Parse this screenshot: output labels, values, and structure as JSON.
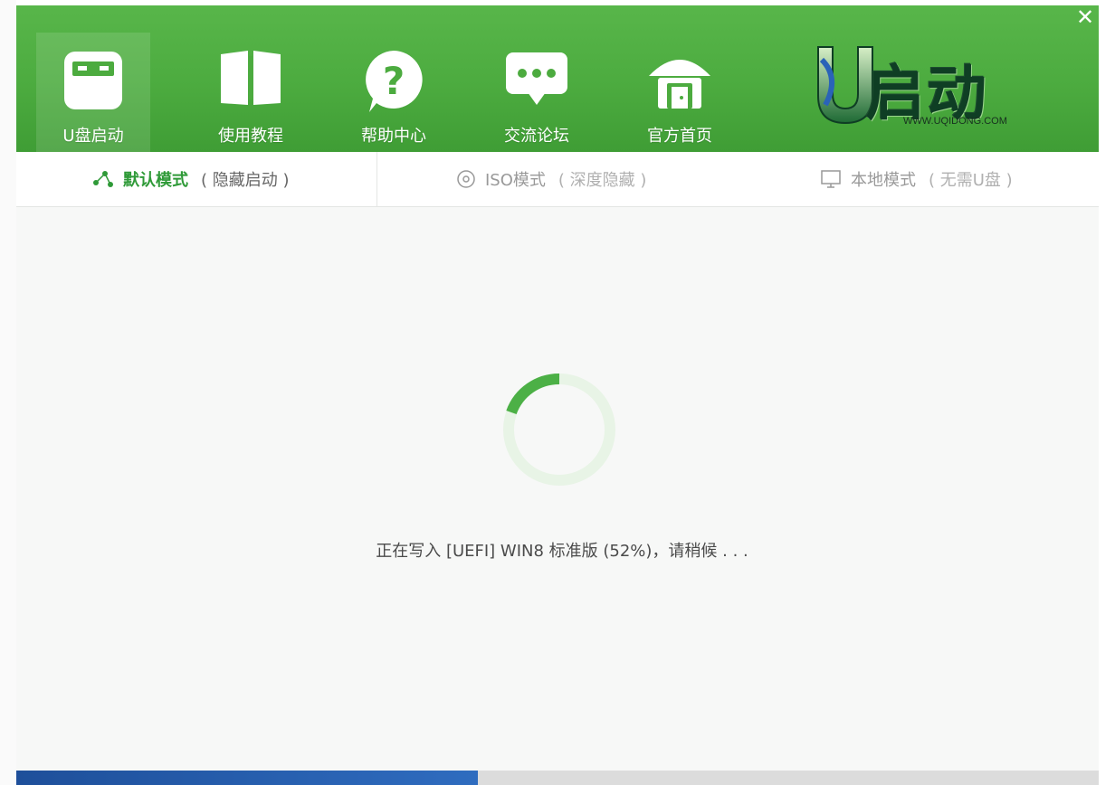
{
  "window": {
    "close_glyph": "✕"
  },
  "nav": {
    "items": [
      {
        "label": "U盘启动",
        "icon": "usb-drive-icon",
        "active": true
      },
      {
        "label": "使用教程",
        "icon": "book-icon",
        "active": false
      },
      {
        "label": "帮助中心",
        "icon": "help-icon",
        "active": false
      },
      {
        "label": "交流论坛",
        "icon": "chat-icon",
        "active": false
      },
      {
        "label": "官方首页",
        "icon": "home-icon",
        "active": false
      }
    ]
  },
  "logo": {
    "text": "启动",
    "url": "WWW.UQIDONG.COM"
  },
  "tabs": [
    {
      "label": "默认模式",
      "sub": "( 隐藏启动 )",
      "icon": "share-icon",
      "active": true
    },
    {
      "label": "ISO模式",
      "sub": "( 深度隐藏 )",
      "icon": "disc-icon",
      "active": false
    },
    {
      "label": "本地模式",
      "sub": "( 无需U盘 )",
      "icon": "monitor-icon",
      "active": false
    }
  ],
  "status": {
    "text": "正在写入 [UEFI] WIN8 标准版 (52%)，请稍候 . . .",
    "progress_percent": 52
  },
  "colors": {
    "brand_green": "#4cab3f",
    "tab_active": "#2f9a38",
    "spinner_track": "#e8f4e6",
    "spinner_arc": "#4cb046"
  }
}
